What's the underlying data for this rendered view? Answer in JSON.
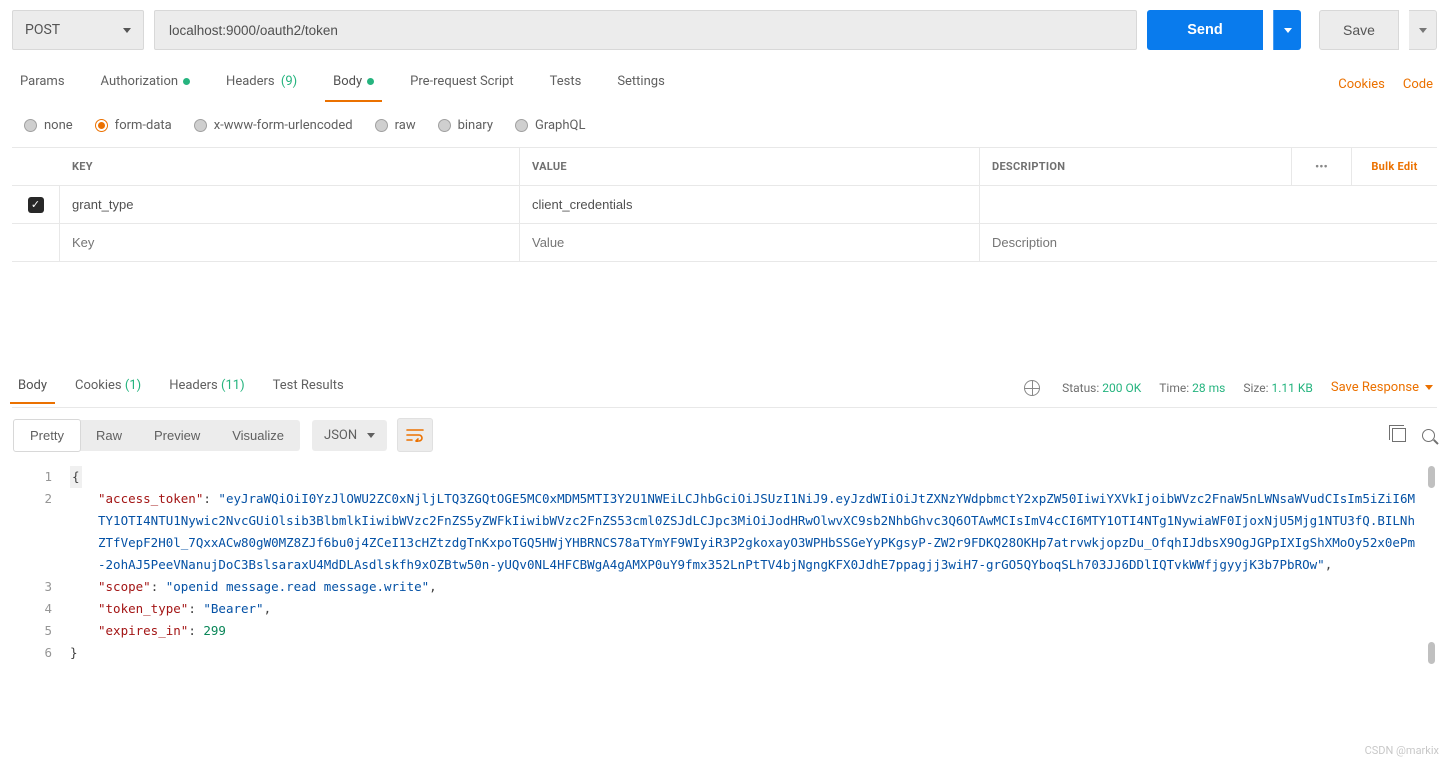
{
  "request": {
    "method": "POST",
    "url": "localhost:9000/oauth2/token",
    "send_label": "Send",
    "save_label": "Save"
  },
  "tabs": {
    "params": "Params",
    "authorization": "Authorization",
    "headers": "Headers",
    "headers_count": "(9)",
    "body": "Body",
    "prerequest": "Pre-request Script",
    "tests": "Tests",
    "settings": "Settings",
    "cookies_link": "Cookies",
    "code_link": "Code"
  },
  "body_types": {
    "none": "none",
    "formdata": "form-data",
    "xwww": "x-www-form-urlencoded",
    "raw": "raw",
    "binary": "binary",
    "graphql": "GraphQL"
  },
  "kv": {
    "header_key": "KEY",
    "header_value": "VALUE",
    "header_desc": "DESCRIPTION",
    "bulk_edit": "Bulk Edit",
    "rows": [
      {
        "key": "grant_type",
        "value": "client_credentials",
        "desc": ""
      }
    ],
    "ph_key": "Key",
    "ph_value": "Value",
    "ph_desc": "Description"
  },
  "response_tabs": {
    "body": "Body",
    "cookies": "Cookies",
    "cookies_count": "(1)",
    "headers": "Headers",
    "headers_count": "(11)",
    "test_results": "Test Results"
  },
  "response_meta": {
    "status_label": "Status:",
    "status_value": "200 OK",
    "time_label": "Time:",
    "time_value": "28 ms",
    "size_label": "Size:",
    "size_value": "1.11 KB",
    "save_response": "Save Response"
  },
  "viewer": {
    "pretty": "Pretty",
    "raw": "Raw",
    "preview": "Preview",
    "visualize": "Visualize",
    "format": "JSON"
  },
  "response_body": {
    "access_token_key": "\"access_token\"",
    "access_token_value": "\"eyJraWQiOiI0YzJlOWU2ZC0xNjljLTQ3ZGQtOGE5MC0xMDM5MTI3Y2U1NWEiLCJhbGciOiJSUzI1NiJ9.eyJzdWIiOiJtZXNzYWdpbmctY2xpZW50IiwiYXVkIjoibWVzc2FnaW5nLWNsaWVudCIsIm5iZiI6MTY1OTI4NTU1Nywic2NvcGUiOlsib3BlbmlkIiwibWVzc2FnZS5yZWFkIiwibWVzc2FnZS53cml0ZSJdLCJpc3MiOiJodHRwOlwvXC9sb2NhbGhvc3Q6OTAwMCIsImV4cCI6MTY1OTI4NTg1NywiaWF0IjoxNjU5Mjg1NTU3fQ.BILNhZTfVepF2H0l_7QxxACw80gW0MZ8ZJf6bu0j4ZCeI13cHZtzdgTnKxpoTGQ5HWjYHBRNCS78aTYmYF9WIyiR3P2gkoxayO3WPHbSSGeYyPKgsyP-ZW2r9FDKQ28OKHp7atrvwkjopzDu_OfqhIJdbsX9OgJGPpIXIgShXMoOy52x0ePm-2ohAJ5PeeVNanujDoC3BslsaraxU4MdDLAsdlskfh9xOZBtw50n-yUQv0NL4HFCBWgA4gAMXP0uY9fmx352LnPtTV4bjNgngKFX0JdhE7ppagjj3wiH7-grGO5QYboqSLh703JJ6DDlIQTvkWWfjgyyjK3b7PbROw\"",
    "scope_key": "\"scope\"",
    "scope_value": "\"openid message.read message.write\"",
    "token_type_key": "\"token_type\"",
    "token_type_value": "\"Bearer\"",
    "expires_in_key": "\"expires_in\"",
    "expires_in_value": "299"
  },
  "watermark": "CSDN @markix"
}
